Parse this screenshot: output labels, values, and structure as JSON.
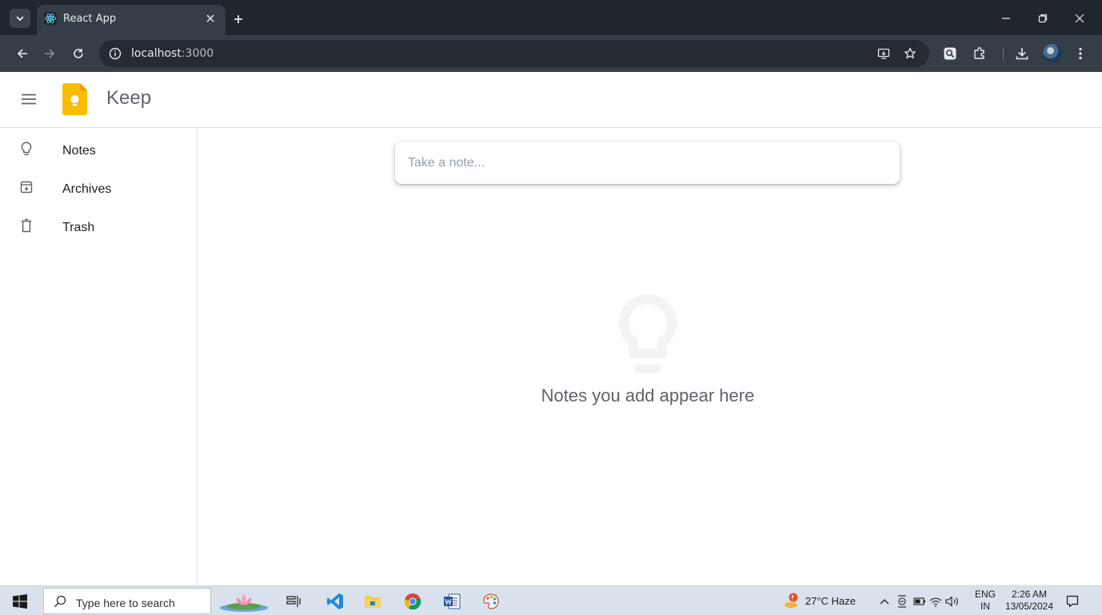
{
  "browser": {
    "tab_title": "React App",
    "url_host": "localhost",
    "url_port": ":3000"
  },
  "app": {
    "title": "Keep"
  },
  "sidebar": {
    "items": [
      {
        "label": "Notes",
        "icon": "lightbulb-icon"
      },
      {
        "label": "Archives",
        "icon": "archive-icon"
      },
      {
        "label": "Trash",
        "icon": "trash-icon"
      }
    ]
  },
  "main": {
    "note_placeholder": "Take a note...",
    "empty_message": "Notes you add appear here"
  },
  "taskbar": {
    "search_placeholder": "Type here to search",
    "weather": "27°C  Haze",
    "language_top": "ENG",
    "language_bottom": "IN",
    "time": "2:26 AM",
    "date": "13/05/2024"
  },
  "colors": {
    "keep_yellow": "#fbbc04",
    "chrome_dark": "#1f262d",
    "chrome_toolbar": "#353e47",
    "text_secondary": "#5f6368"
  }
}
